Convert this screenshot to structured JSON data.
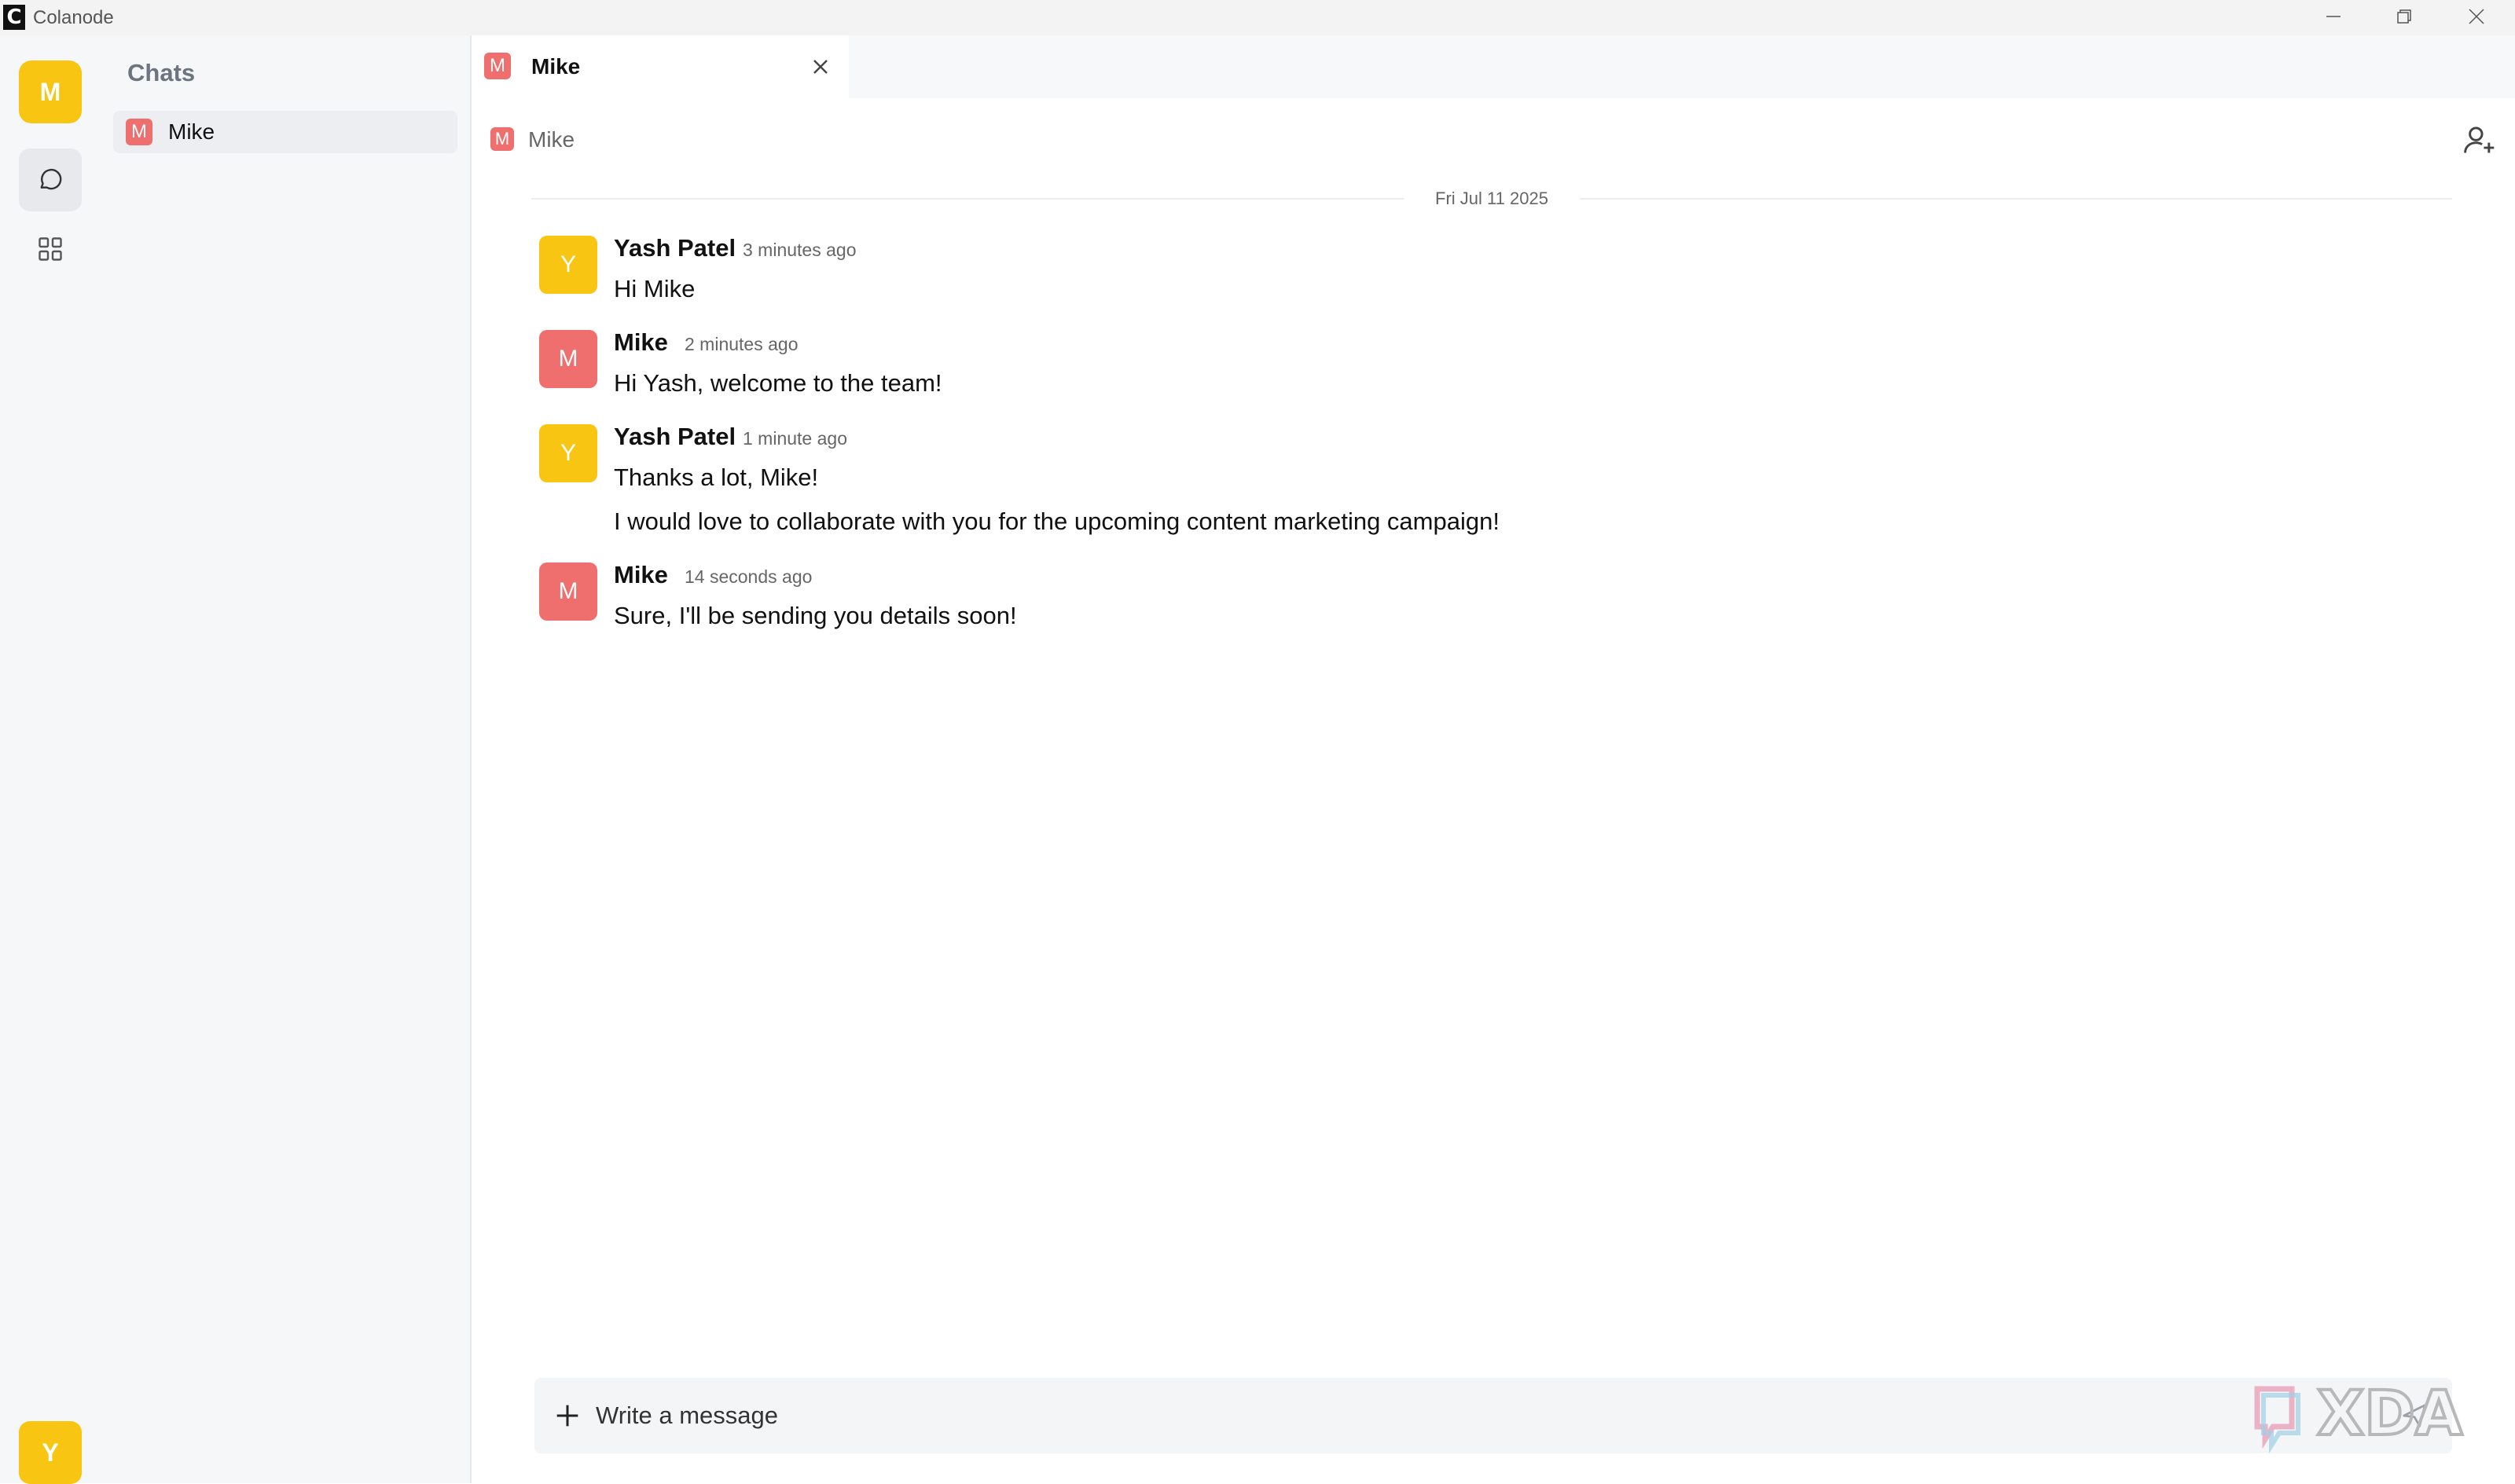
{
  "app": {
    "title": "Colanode",
    "logo_letter": "C"
  },
  "window_controls": {
    "minimize": "minimize-icon",
    "restore": "restore-icon",
    "close": "close-icon"
  },
  "rail": {
    "workspace_avatar": "M",
    "chats_icon": "chat-bubble-icon",
    "apps_icon": "grid-icon",
    "user_avatar": "Y"
  },
  "sidebar": {
    "title": "Chats",
    "items": [
      {
        "avatar": "M",
        "label": "Mike",
        "selected": true
      }
    ]
  },
  "tabs": [
    {
      "avatar": "M",
      "label": "Mike",
      "active": true
    }
  ],
  "chat_header": {
    "avatar": "M",
    "name": "Mike",
    "add_member_icon": "user-plus-icon"
  },
  "date_divider": "Fri Jul 11 2025",
  "messages": [
    {
      "author": "Yash Patel",
      "avatar": "Y",
      "time": "3 minutes ago",
      "lines": [
        "Hi Mike"
      ]
    },
    {
      "author": "Mike",
      "avatar": "M",
      "time": "2 minutes ago",
      "lines": [
        "Hi Yash, welcome to the team!"
      ]
    },
    {
      "author": "Yash Patel",
      "avatar": "Y",
      "time": "1 minute ago",
      "lines": [
        "Thanks a lot, Mike!",
        "I would love to collaborate with you for the upcoming content marketing campaign!"
      ]
    },
    {
      "author": "Mike",
      "avatar": "M",
      "time": "14 seconds ago",
      "lines": [
        "Sure, I'll be sending you details soon!"
      ]
    }
  ],
  "composer": {
    "placeholder": "Write a message",
    "value": "",
    "attach_icon": "plus-icon",
    "send_icon": "send-icon"
  },
  "colors": {
    "accent_yellow": "#f8c512",
    "accent_red": "#ef6f6f"
  },
  "watermark": {
    "text": "XDA"
  }
}
